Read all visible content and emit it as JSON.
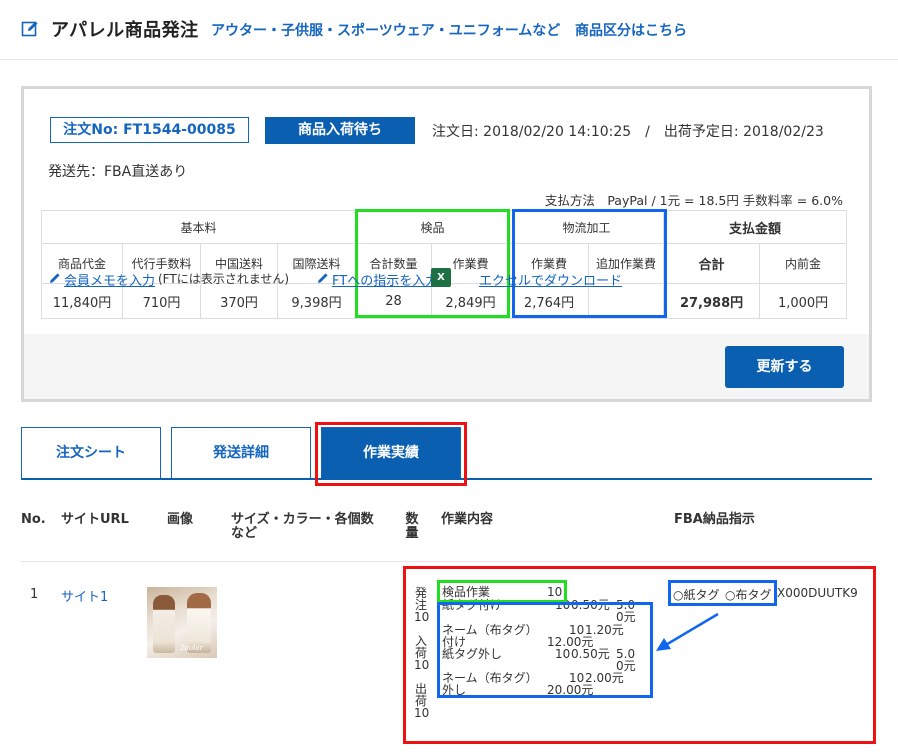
{
  "header": {
    "title": "アパレル商品発注",
    "category_link": "アウター・子供服・スポーツウェア・ユニフォームなど",
    "category_list_link": "商品区分はこちら"
  },
  "order": {
    "order_no": "注文No: FT1544-00085",
    "status": "商品入荷待ち",
    "dates": "注文日: 2018/02/20 14:10:25　/　出荷予定日: 2018/02/23",
    "ship_to": "発送先：FBA直送あり",
    "payment": "支払方法　PayPal  / 1元 = 18.5円 手数料率 = 6.0%"
  },
  "fees": {
    "groups": {
      "basic": "基本料",
      "inspection": "検品",
      "logistics": "物流加工",
      "payment": "支払金額"
    },
    "headers": [
      "商品代金",
      "代行手数料",
      "中国送料",
      "国際送料",
      "合計数量",
      "作業費",
      "作業費",
      "追加作業費",
      "合計",
      "内前金"
    ],
    "values": [
      "11,840円",
      "710円",
      "370円",
      "9,398円",
      "28",
      "2,849円",
      "2,764円",
      "",
      "27,988円",
      "1,000円"
    ]
  },
  "actions": {
    "memo_link": "会員メモを入力",
    "memo_note": "(FTには表示されません)",
    "instruction_link": "FTへの指示を入力",
    "excel_icon": "X",
    "excel_link": "エクセルでダウンロード",
    "update_button": "更新する"
  },
  "tabs": [
    "注文シート",
    "発送詳細",
    "作業実績"
  ],
  "columns": {
    "no": "No.",
    "site_url": "サイトURL",
    "image": "画像",
    "size_color": [
      "サイズ・カラー・各個数",
      "など"
    ],
    "qty": [
      "数",
      "量"
    ],
    "work": "作業内容",
    "fba": "FBA納品指示"
  },
  "item": {
    "no": "1",
    "site_link": "サイト1",
    "image_brand": "2dolar",
    "status_lines": [
      "発",
      "注",
      "10",
      "",
      "入",
      "荷",
      "10",
      "",
      "出",
      "荷",
      "10"
    ],
    "work": [
      {
        "name": "検品作業",
        "qty": "10",
        "price": "",
        "total": ""
      },
      {
        "name": "紙タグ付け",
        "qty": "10",
        "price": "0.50元",
        "total": "5.00元"
      },
      {
        "name": "ネーム（布タグ）付け",
        "qty": "10",
        "price": "1.20元",
        "total": "12.00元"
      },
      {
        "name": "紙タグ外し",
        "qty": "10",
        "price": "0.50元",
        "total": "5.00元"
      },
      {
        "name": "ネーム（布タグ）外し",
        "qty": "10",
        "price": "2.00元",
        "total": "20.00元"
      }
    ],
    "fba": {
      "paper_tag": "○紙タグ",
      "cloth_tag": "○布タグ",
      "code": "X000DUUTK9"
    }
  },
  "colors": {
    "accent_blue": "#0b5fb0",
    "link_blue": "#1565c0",
    "highlight_green": "#22dd22",
    "highlight_blue": "#1166ee",
    "highlight_red": "#ee1111"
  }
}
